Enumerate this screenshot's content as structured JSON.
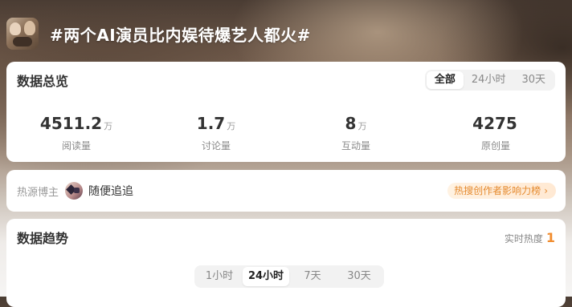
{
  "topic": {
    "title": "#两个AI演员比内娱待爆艺人都火#",
    "cover_icon": "topic-cover-image"
  },
  "overview": {
    "title": "数据总览",
    "tabs": [
      {
        "label": "全部",
        "active": true
      },
      {
        "label": "24小时",
        "active": false
      },
      {
        "label": "30天",
        "active": false
      }
    ],
    "stats": [
      {
        "value": "4511.2",
        "unit": "万",
        "label": "阅读量"
      },
      {
        "value": "1.7",
        "unit": "万",
        "label": "讨论量"
      },
      {
        "value": "8",
        "unit": "万",
        "label": "互动量"
      },
      {
        "value": "4275",
        "unit": "",
        "label": "原创量"
      }
    ]
  },
  "source": {
    "label": "热源博主",
    "host_name": "随便追追",
    "rank_link": "热搜创作者影响力榜",
    "rank_chevron": "›"
  },
  "trend": {
    "title": "数据趋势",
    "heat_label": "实时热度",
    "heat_value": "1",
    "tabs": [
      {
        "label": "1小时",
        "active": false
      },
      {
        "label": "24小时",
        "active": true
      },
      {
        "label": "7天",
        "active": false
      },
      {
        "label": "30天",
        "active": false
      }
    ]
  },
  "colors": {
    "accent_orange": "#f18c2e",
    "rank_text": "#e58a2e"
  }
}
